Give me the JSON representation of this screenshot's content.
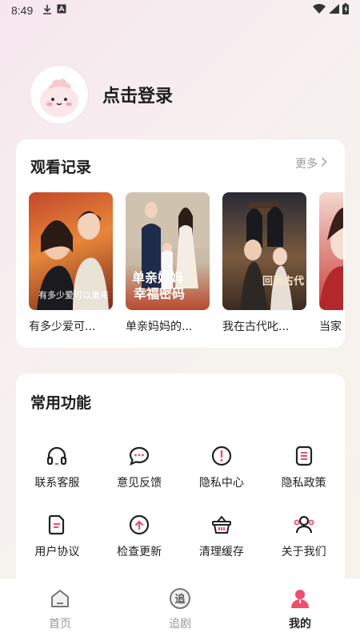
{
  "status_bar": {
    "time": "8:49"
  },
  "profile": {
    "login_label": "点击登录"
  },
  "history": {
    "title": "观看记录",
    "more_label": "更多",
    "items": [
      {
        "title": "有多少爱可...",
        "poster_text": "有多少爱可以重来"
      },
      {
        "title": "单亲妈妈的...",
        "poster_text": "单亲妈妈幸福密码"
      },
      {
        "title": "我在古代叱...",
        "poster_text": "回到古代"
      },
      {
        "title": "当家",
        "poster_text": ""
      }
    ]
  },
  "functions": {
    "title": "常用功能",
    "items": [
      {
        "label": "联系客服",
        "icon": "headset-icon"
      },
      {
        "label": "意见反馈",
        "icon": "chat-bubble-icon"
      },
      {
        "label": "隐私中心",
        "icon": "exclamation-circle-icon"
      },
      {
        "label": "隐私政策",
        "icon": "document-list-icon"
      },
      {
        "label": "用户协议",
        "icon": "agreement-doc-icon"
      },
      {
        "label": "检查更新",
        "icon": "upload-arrow-icon"
      },
      {
        "label": "清理缓存",
        "icon": "basket-icon"
      },
      {
        "label": "关于我们",
        "icon": "users-icon"
      }
    ]
  },
  "nav": {
    "items": [
      {
        "label": "首页",
        "icon": "home-icon",
        "active": false
      },
      {
        "label": "追剧",
        "icon": "follow-icon",
        "icon_text": "追",
        "active": false
      },
      {
        "label": "我的",
        "icon": "profile-icon",
        "active": true
      }
    ]
  },
  "colors": {
    "accent": "#f04e6a",
    "icon_stroke": "#222222",
    "muted": "#999999"
  }
}
